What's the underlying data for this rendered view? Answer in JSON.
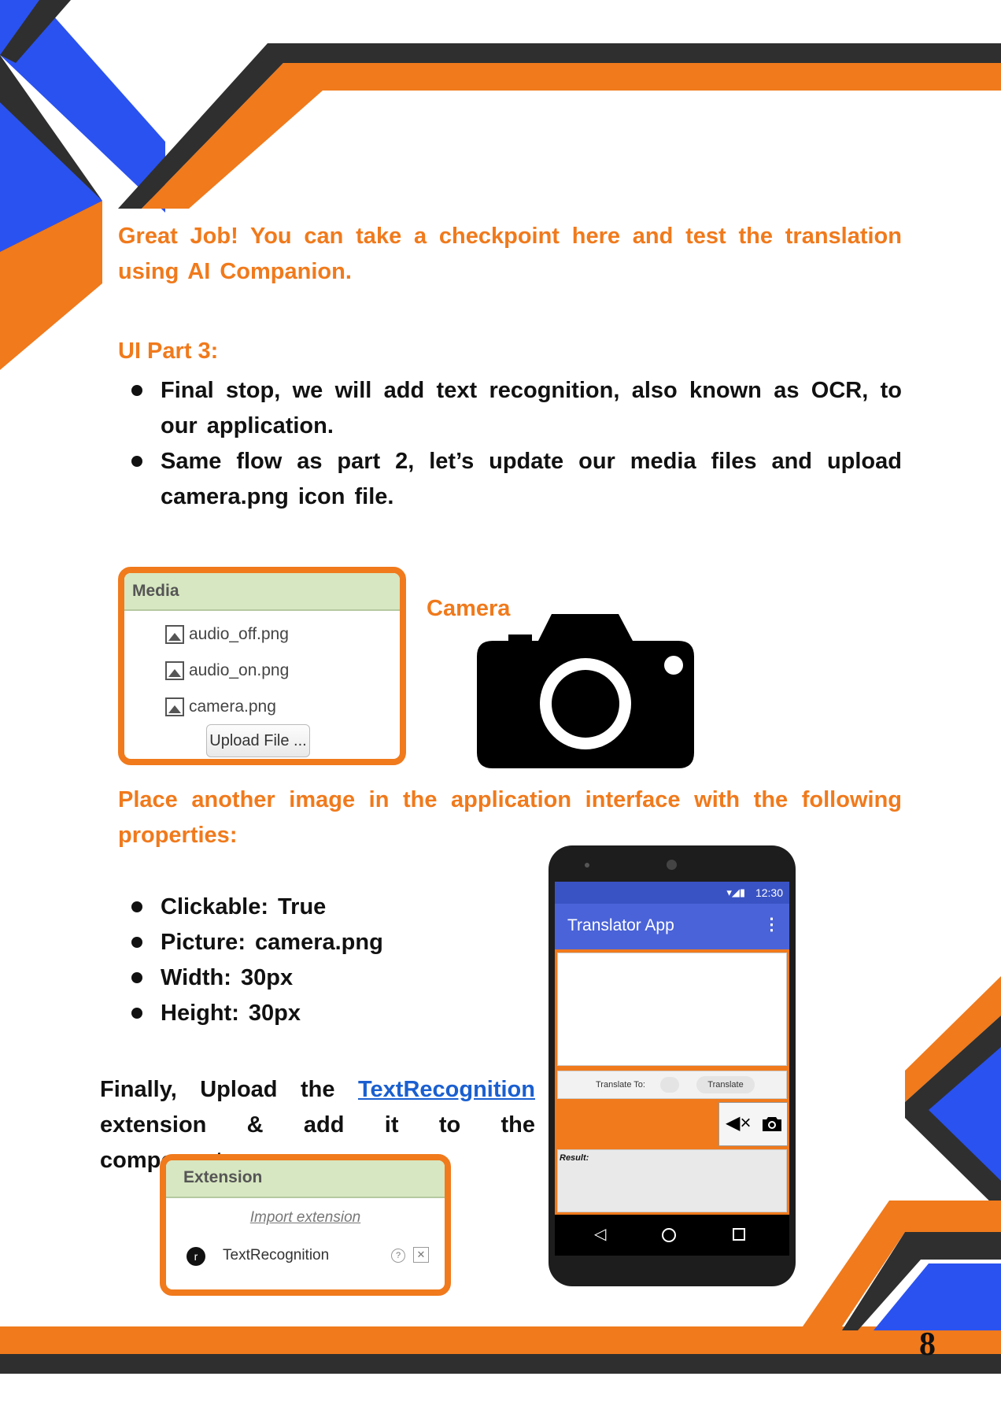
{
  "intro_paragraph": "Great Job! You can take a checkpoint here and test the translation using AI Companion.",
  "section_title": "UI Part 3:",
  "part3_bullets": [
    "Final stop, we will add text recognition, also known as OCR, to our application.",
    "Same flow as part 2, let’s update our media files and upload camera.png icon file."
  ],
  "media_panel": {
    "header": "Media",
    "files": [
      "audio_off.png",
      "audio_on.png",
      "camera.png"
    ],
    "upload_label": "Upload File ..."
  },
  "camera_label": "Camera",
  "image_instruction": "Place another image in the application interface with the following properties:",
  "properties": [
    "Clickable: True",
    "Picture: camera.png",
    "Width: 30px",
    "Height: 30px"
  ],
  "final": {
    "before": "Finally, Upload the ",
    "link": "TextRecognition",
    "after": " extension & add it to the components."
  },
  "extension_panel": {
    "header": "Extension",
    "import_label": "Import extension",
    "item": "TextRecognition"
  },
  "phone": {
    "time": "12:30",
    "app_title": "Translator App",
    "translate_to_label": "Translate To:",
    "translate_button": "Translate",
    "result_label": "Result:"
  },
  "page_number": "8",
  "colors": {
    "orange": "#f07a1c",
    "blue": "#2a52f0",
    "dark": "#2f2f2f",
    "app_blue": "#4a63d8"
  }
}
